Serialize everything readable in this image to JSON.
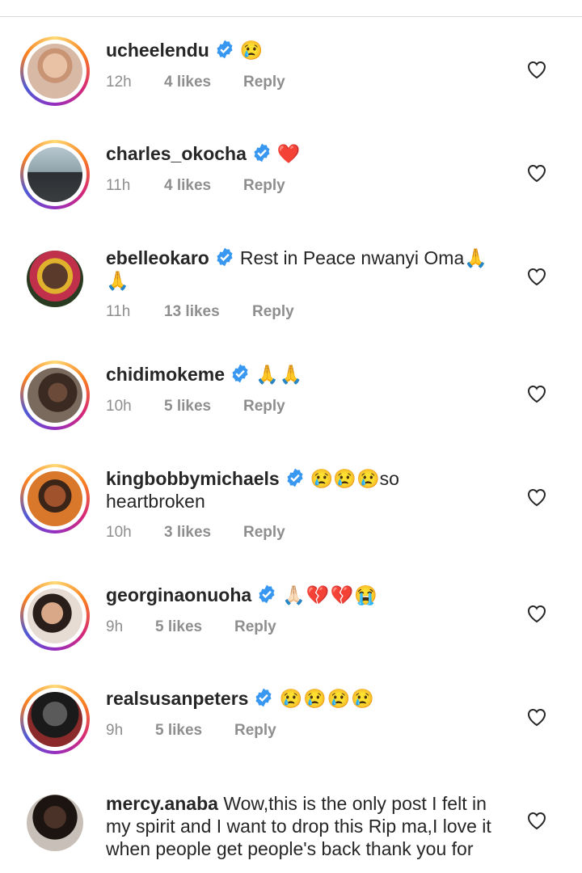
{
  "comments": [
    {
      "username": "ucheelendu",
      "text": "😢",
      "time": "12h",
      "likes": "4 likes",
      "reply": "Reply"
    },
    {
      "username": "charles_okocha",
      "text": "❤️",
      "time": "11h",
      "likes": "4 likes",
      "reply": "Reply"
    },
    {
      "username": "ebelleokaro",
      "text": "Rest in Peace  nwanyi Oma🙏🙏",
      "time": "11h",
      "likes": "13 likes",
      "reply": "Reply"
    },
    {
      "username": "chidimokeme",
      "text": "🙏🙏",
      "time": "10h",
      "likes": "5 likes",
      "reply": "Reply"
    },
    {
      "username": "kingbobbymichaels",
      "text": "😢😢😢so heartbroken",
      "time": "10h",
      "likes": "3 likes",
      "reply": "Reply"
    },
    {
      "username": "georginaonuoha",
      "text": "🙏🏻💔💔😭",
      "time": "9h",
      "likes": "5 likes",
      "reply": "Reply"
    },
    {
      "username": "realsusanpeters",
      "text": "😢😢😢😢",
      "time": "9h",
      "likes": "5 likes",
      "reply": "Reply"
    },
    {
      "username": "mercy.anaba",
      "text": "Wow,this is the only post I felt in my spirit and I want to drop this Rip ma,I love it when people get people's back thank you for",
      "time": "",
      "likes": "",
      "reply": ""
    }
  ],
  "colors": {
    "verified": "#3897f0",
    "meta": "#8e8e8e",
    "text": "#262626"
  },
  "icons": {
    "like": "heart-outline-icon",
    "verified": "verified-badge-icon"
  }
}
